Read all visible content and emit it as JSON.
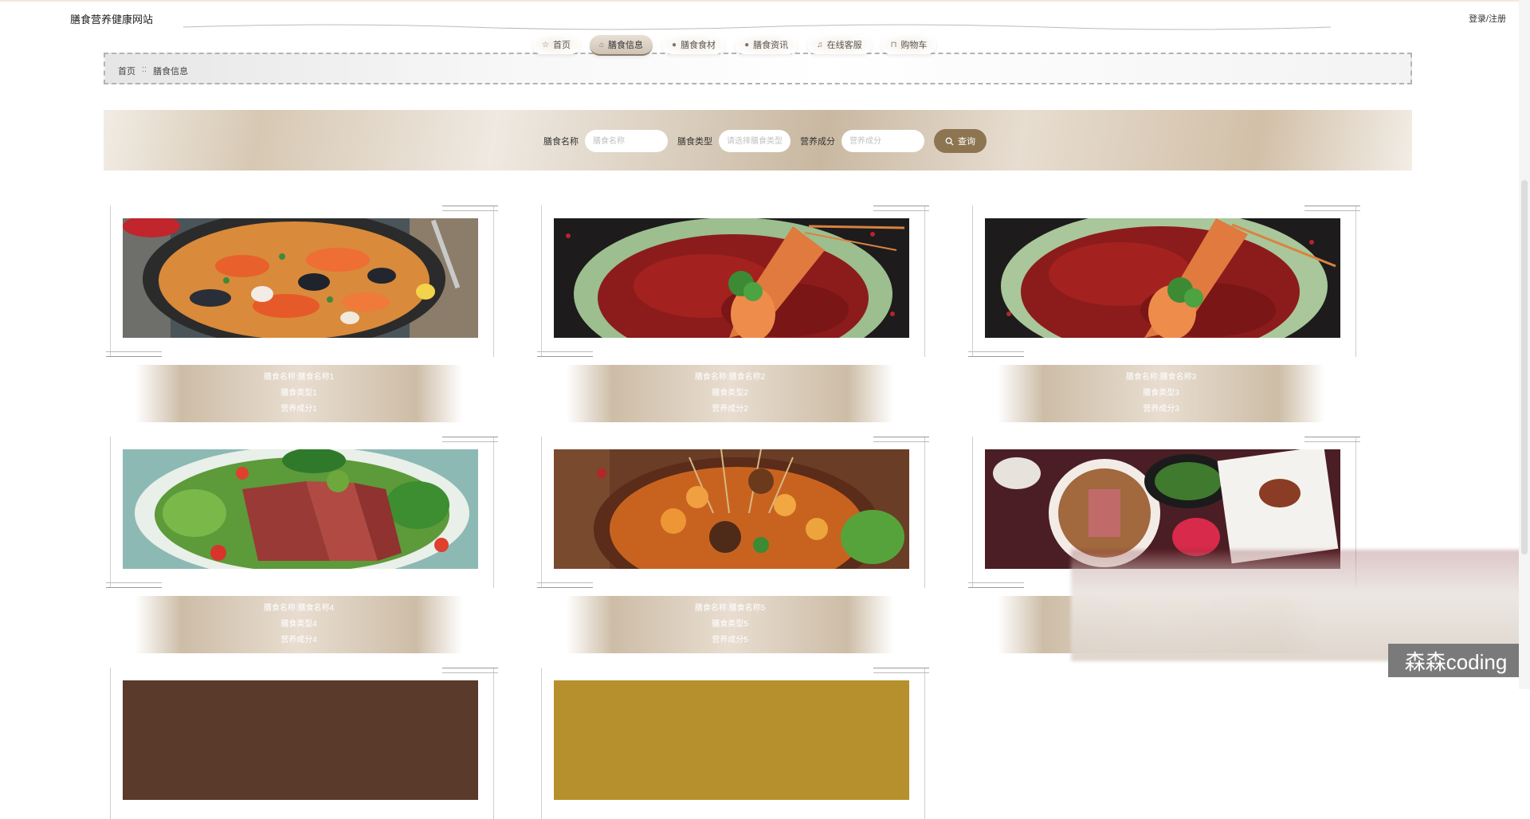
{
  "header": {
    "site_title": "膳食营养健康网站",
    "login_label": "登录/注册"
  },
  "nav": {
    "items": [
      {
        "label": "首页",
        "icon": "home-icon",
        "glyph": "☆"
      },
      {
        "label": "膳食信息",
        "icon": "bag-icon",
        "glyph": "⌂"
      },
      {
        "label": "膳食食材",
        "icon": "info-icon",
        "glyph": "●"
      },
      {
        "label": "膳食资讯",
        "icon": "info-icon",
        "glyph": "●"
      },
      {
        "label": "在线客服",
        "icon": "headset-icon",
        "glyph": "♫"
      },
      {
        "label": "购物车",
        "icon": "cart-icon",
        "glyph": "⊓"
      }
    ],
    "active_index": 1
  },
  "breadcrumb": {
    "home": "首页",
    "separator": "::",
    "current": "膳食信息"
  },
  "search": {
    "name_label": "膳食名称",
    "name_placeholder": "膳食名称",
    "type_label": "膳食类型",
    "type_placeholder": "请选择膳食类型",
    "nutrition_label": "营养成分",
    "nutrition_placeholder": "营养成分",
    "button_label": "查询",
    "button_color": "#8d7551"
  },
  "cards": [
    {
      "name": "膳食名称:膳食名称1",
      "type": "膳食类型1",
      "nutrition": "营养成分1",
      "image": "seafood-paella-photo"
    },
    {
      "name": "膳食名称:膳食名称2",
      "type": "膳食类型2",
      "nutrition": "营养成分2",
      "image": "spicy-lobster-photo"
    },
    {
      "name": "膳食名称:膳食名称3",
      "type": "膳食类型3",
      "nutrition": "营养成分3",
      "image": "spicy-lobster-photo"
    },
    {
      "name": "膳食名称:膳食名称4",
      "type": "膳食类型4",
      "nutrition": "营养成分4",
      "image": "beef-salad-photo"
    },
    {
      "name": "膳食名称:膳食名称5",
      "type": "膳食类型5",
      "nutrition": "营养成分5",
      "image": "seafood-skewers-photo"
    },
    {
      "name": "",
      "type": "",
      "nutrition": "",
      "image": "chinese-banquet-photo"
    }
  ],
  "watermark": "森森coding"
}
